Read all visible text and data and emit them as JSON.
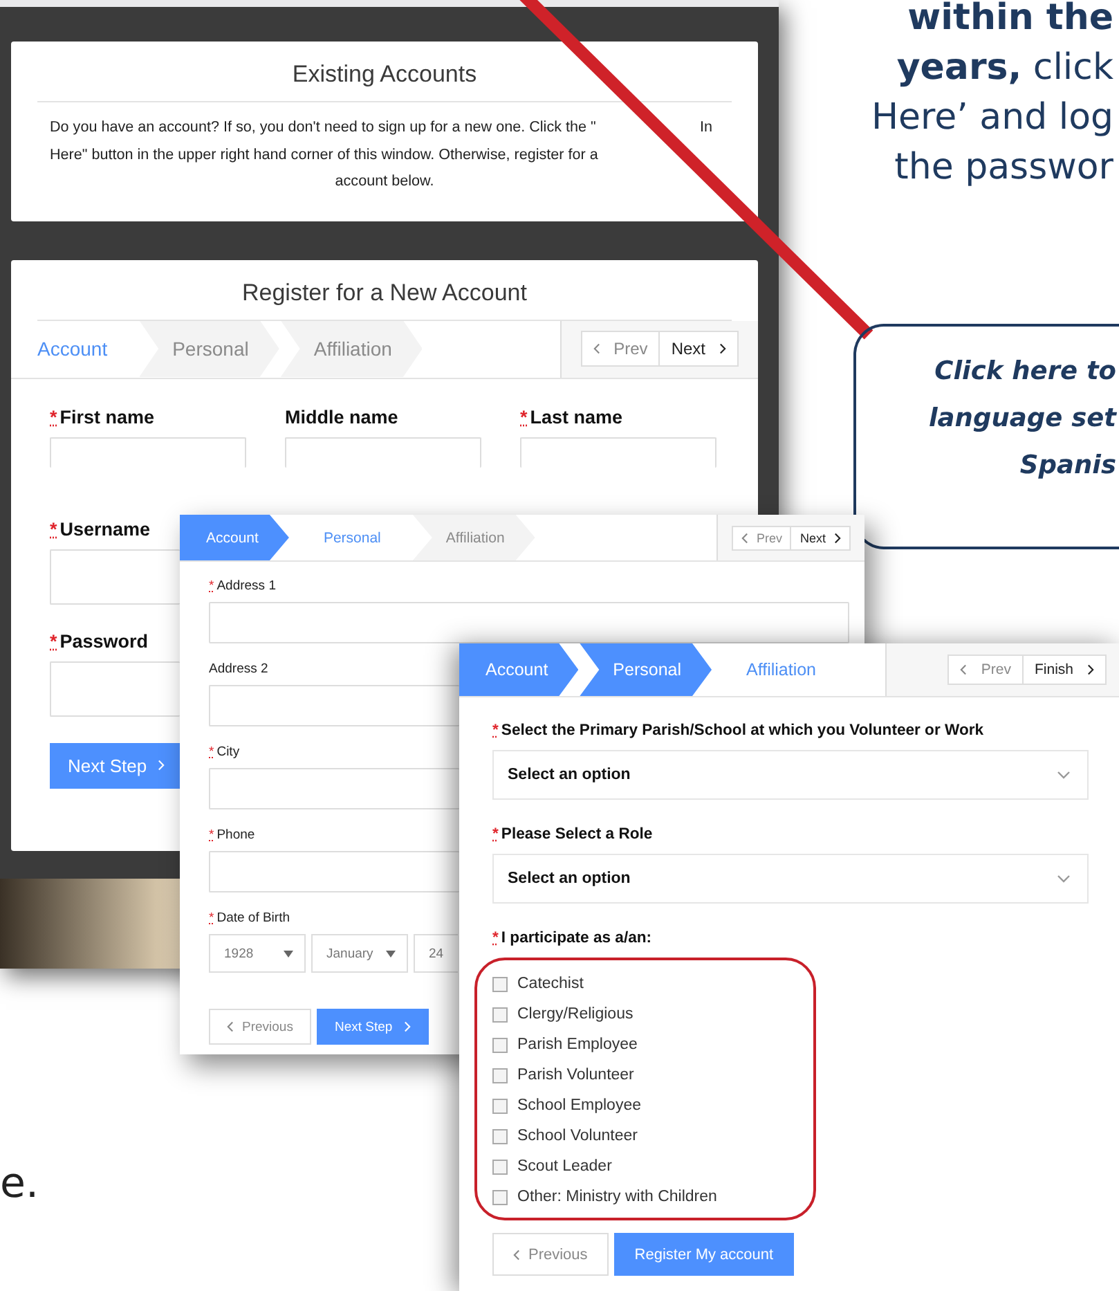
{
  "slide_text": {
    "lines": [
      "**within the**",
      "**years,** click",
      "Here’ and log",
      "the passwor"
    ]
  },
  "callout": {
    "lines": [
      "Click here to",
      "language set",
      "Spanis"
    ]
  },
  "slide_fragment": "e.",
  "background_page": {
    "existing_card": {
      "title": "Existing Accounts",
      "text_lines": [
        [
          "Do you have an account? If so, you don't need to sign up for a new one. Click the \"",
          "In"
        ],
        [
          "Here\" button in the upper right hand corner of this window. Otherwise, register for a"
        ],
        [
          "account below."
        ]
      ]
    },
    "register_card": {
      "title": "Register for a New Account",
      "tabs": [
        {
          "label": "Account",
          "selected": true,
          "completed": false
        },
        {
          "label": "Personal",
          "selected": false,
          "completed": false
        },
        {
          "label": "Affiliation",
          "selected": false,
          "completed": false
        }
      ],
      "pager": {
        "prev": "Prev",
        "next": "Next"
      },
      "field_rows": [
        [
          {
            "label": "First name",
            "mark": "*"
          },
          {
            "label": "Middle name"
          },
          {
            "label": "Last name",
            "mark": "*"
          }
        ],
        [
          {
            "label": "Username",
            "mark": "*"
          }
        ],
        [
          {
            "label": "Password",
            "mark": "*"
          }
        ]
      ],
      "next_button": "Next Step"
    }
  },
  "personal_window": {
    "tabs": [
      {
        "label": "Account",
        "selected": false,
        "completed": true
      },
      {
        "label": "Personal",
        "selected": true,
        "completed": false
      },
      {
        "label": "Affiliation",
        "selected": false,
        "completed": false
      }
    ],
    "pager": {
      "prev": "Prev",
      "next": "Next"
    },
    "fields": [
      {
        "label": "Address 1",
        "mark": "*"
      },
      {
        "label": "Address 2"
      },
      {
        "label": "City",
        "mark": "*"
      },
      {
        "label": "Phone",
        "mark": "*"
      }
    ],
    "birth_date": {
      "label": "Date of Birth",
      "mark": "*",
      "values": [
        "1928",
        "January",
        "24"
      ]
    },
    "previous_button": "Previous",
    "next_button": "Next Step"
  },
  "affiliation_window": {
    "tabs": [
      {
        "label": "Account",
        "selected": false,
        "completed": true
      },
      {
        "label": "Personal",
        "selected": false,
        "completed": true
      },
      {
        "label": "Affiliation",
        "selected": true,
        "completed": false
      }
    ],
    "pager": {
      "prev": "Prev",
      "next": "Finish"
    },
    "selects": [
      {
        "label": "Select the Primary Parish/School at which you Volunteer or Work",
        "mark": "*",
        "placeholder": "Select an option"
      },
      {
        "label": "Please Select a Role",
        "mark": "*",
        "placeholder": "Select an option"
      }
    ],
    "checklist": {
      "label": "I participate as a/an:",
      "mark": "*",
      "options": [
        {
          "label": "Catechist",
          "checked": false
        },
        {
          "label": "Clergy/Religious",
          "checked": false
        },
        {
          "label": "Parish Employee",
          "checked": false
        },
        {
          "label": "Parish Volunteer",
          "checked": false
        },
        {
          "label": "School Employee",
          "checked": false
        },
        {
          "label": "School Volunteer",
          "checked": false
        },
        {
          "label": "Scout Leader",
          "checked": false
        },
        {
          "label": "Other: Ministry with Children",
          "checked": false
        }
      ]
    },
    "previous_button": "Previous",
    "register_button": "Register My account"
  }
}
